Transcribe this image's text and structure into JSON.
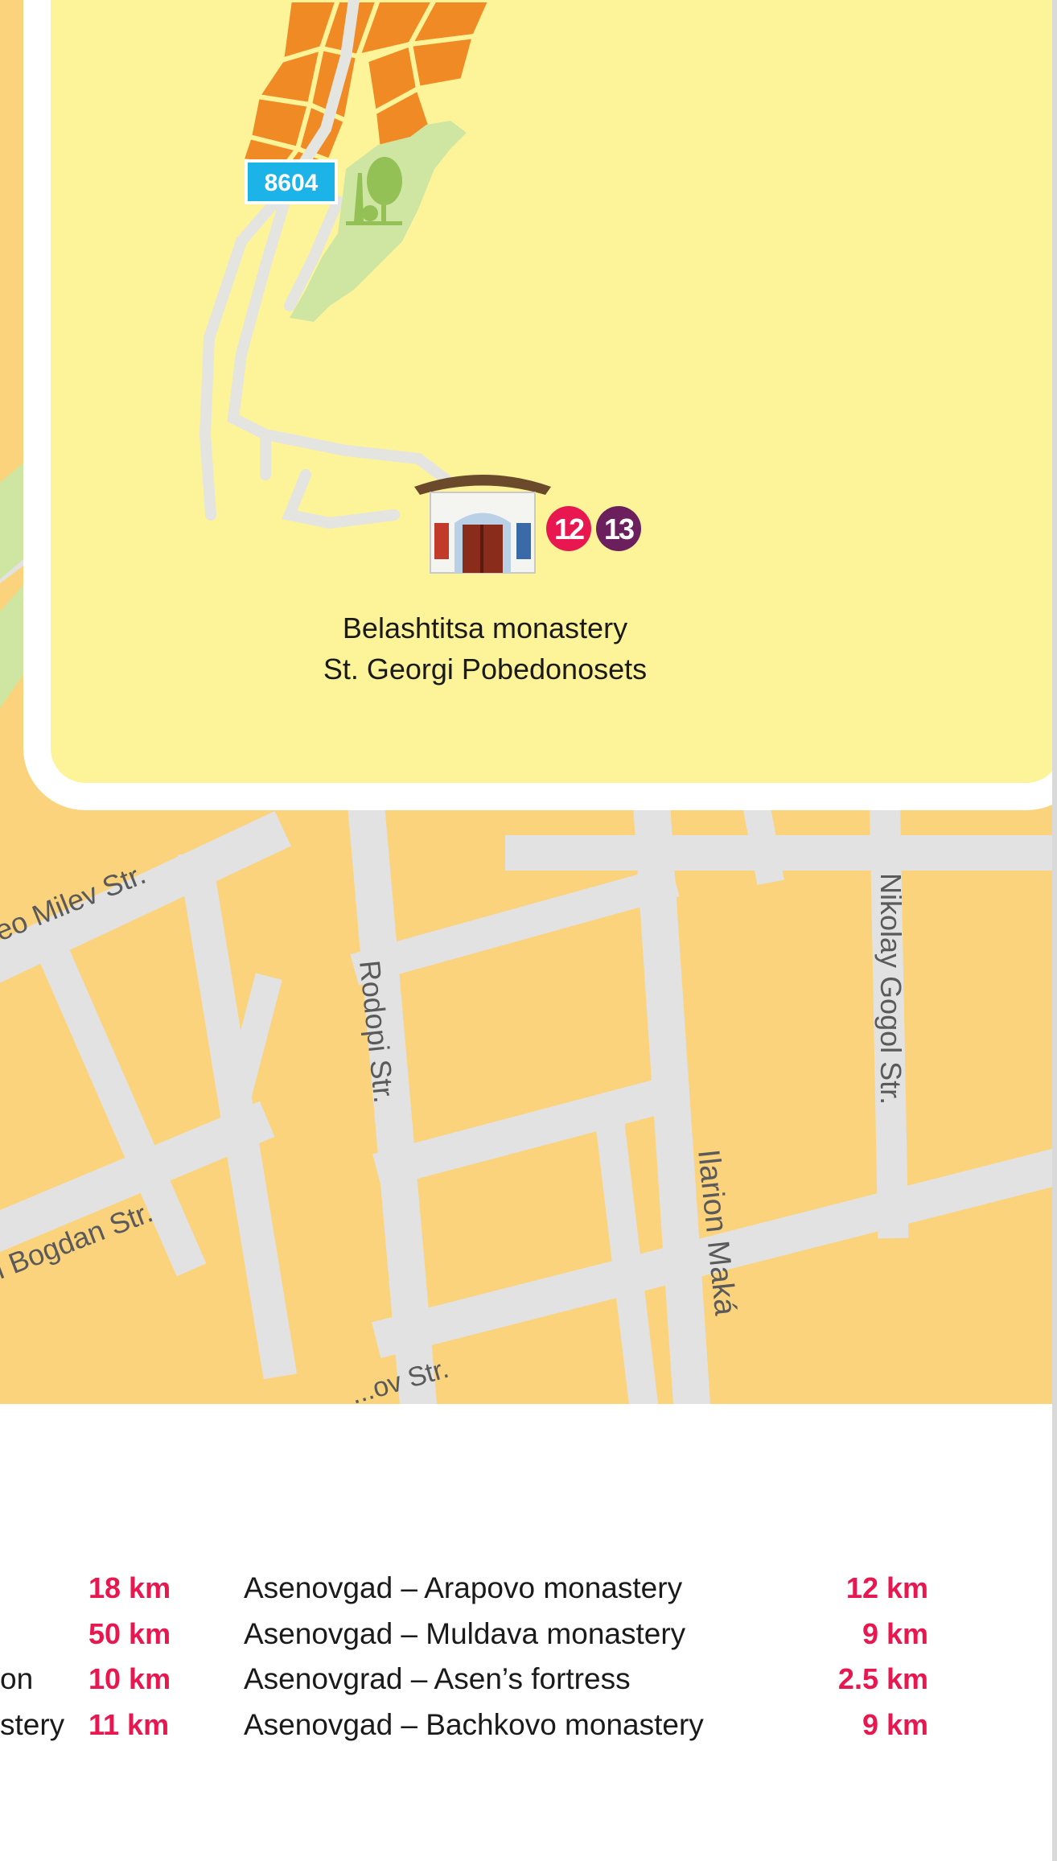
{
  "map": {
    "road_badge": "8604",
    "poi": {
      "name_line1": "Belashtitsa monastery",
      "name_line2": "St. Georgi Pobedonosets",
      "route_numbers": [
        "12",
        "13"
      ],
      "icon": "monastery-chapel-icon"
    },
    "streets": {
      "geo_milev": "eo Milev Str.",
      "bogdan": "i Bogdan Str.",
      "rodopi": "Rodopi Str.",
      "nikolay_gogol": "Nikolay Gogol Str.",
      "ilarion": "Ilarion Maká",
      "bottom_partial": "...ov Str."
    },
    "colors": {
      "highlight_area": "#fdf49a",
      "city_blocks": "#fbd37c",
      "streets": "#e2e2e2",
      "old_town": "#f08a24",
      "park": "#cfe6a3",
      "route_12": "#e8174f",
      "route_13": "#6b1f5c",
      "road_badge": "#1bb3e8"
    }
  },
  "distances": {
    "left_column": [
      {
        "label": "",
        "km": "18 km"
      },
      {
        "label": "",
        "km": "50 km"
      },
      {
        "label": "on",
        "km": "10 km"
      },
      {
        "label": "stery",
        "km": "11 km"
      }
    ],
    "right_column": [
      {
        "label": "Asenovgad – Arapovo monastery",
        "km": "12 km"
      },
      {
        "label": "Asenovgad – Muldava monastery",
        "km": "9 km"
      },
      {
        "label": "Asenovgrad – Asen’s fortress",
        "km": "2.5 km"
      },
      {
        "label": "Asenovgad – Bachkovo monastery",
        "km": "9 km"
      }
    ]
  }
}
